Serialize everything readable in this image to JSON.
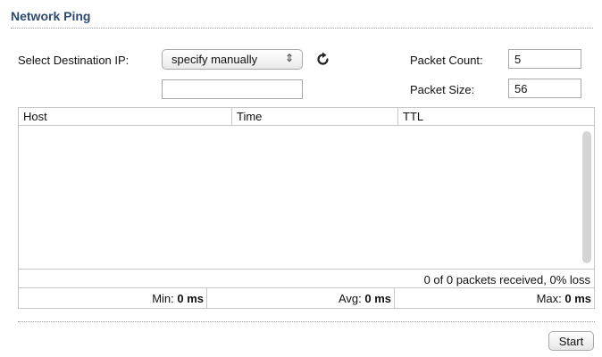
{
  "panel": {
    "title": "Network Ping"
  },
  "form": {
    "destination_label": "Select Destination IP:",
    "destination_selected": "specify manually",
    "destination_arrows": "⇕",
    "manual_ip_value": "",
    "packet_count_label": "Packet Count:",
    "packet_count_value": "5",
    "packet_size_label": "Packet Size:",
    "packet_size_value": "56",
    "refresh_icon": "refresh-icon"
  },
  "results_table": {
    "columns": [
      "Host",
      "Time",
      "TTL"
    ],
    "rows": [],
    "summary": "0 of 0 packets received, 0% loss",
    "min_label": "Min:",
    "min_value": "0 ms",
    "avg_label": "Avg:",
    "avg_value": "0 ms",
    "max_label": "Max:",
    "max_value": "0 ms"
  },
  "actions": {
    "start_label": "Start"
  },
  "colors": {
    "title": "#2e4a72",
    "border": "#c6c6c6",
    "scrollbar": "#d4d4d4"
  }
}
